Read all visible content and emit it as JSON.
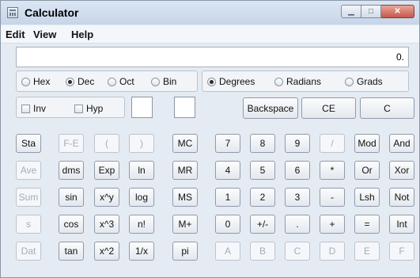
{
  "window": {
    "title": "Calculator"
  },
  "menu": [
    "Edit",
    "View",
    "Help"
  ],
  "display": {
    "value": "0."
  },
  "base": {
    "options": [
      "Hex",
      "Dec",
      "Oct",
      "Bin"
    ],
    "selected": "Dec"
  },
  "angle": {
    "options": [
      "Degrees",
      "Radians",
      "Grads"
    ],
    "selected": "Degrees"
  },
  "checks": {
    "inv": "Inv",
    "hyp": "Hyp"
  },
  "top_buttons": {
    "backspace": "Backspace",
    "ce": "CE",
    "c": "C"
  },
  "keys": {
    "sta": "Sta",
    "fe": "F-E",
    "lparen": "(",
    "rparen": ")",
    "mc": "MC",
    "n7": "7",
    "n8": "8",
    "n9": "9",
    "div": "/",
    "mod": "Mod",
    "and": "And",
    "ave": "Ave",
    "dms": "dms",
    "exp": "Exp",
    "ln": "ln",
    "mr": "MR",
    "n4": "4",
    "n5": "5",
    "n6": "6",
    "mul": "*",
    "or": "Or",
    "xor": "Xor",
    "sum": "Sum",
    "sin": "sin",
    "xpowy": "x^y",
    "log": "log",
    "ms": "MS",
    "n1": "1",
    "n2": "2",
    "n3": "3",
    "minus": "-",
    "lsh": "Lsh",
    "not": "Not",
    "s": "s",
    "cos": "cos",
    "xcube": "x^3",
    "fact": "n!",
    "mplus": "M+",
    "n0": "0",
    "plusminus": "+/-",
    "dot": ".",
    "plus": "+",
    "eq": "=",
    "int": "Int",
    "dat": "Dat",
    "tan": "tan",
    "xsq": "x^2",
    "recip": "1/x",
    "pi": "pi",
    "hA": "A",
    "hB": "B",
    "hC": "C",
    "hD": "D",
    "hE": "E",
    "hF": "F"
  }
}
